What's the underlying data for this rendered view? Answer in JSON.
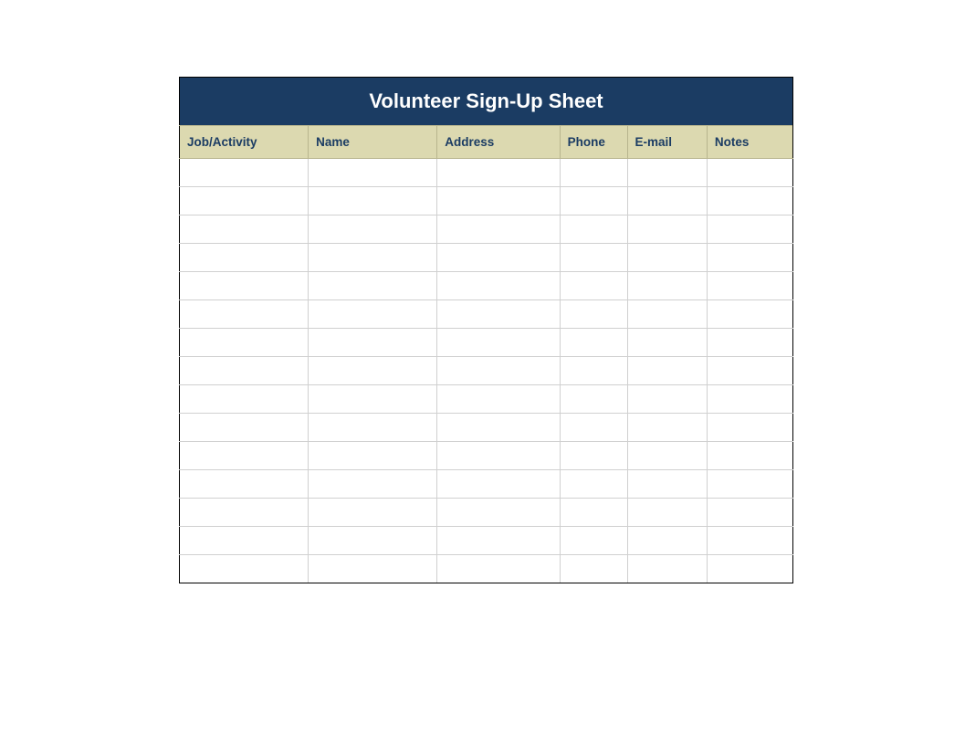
{
  "title": "Volunteer Sign-Up Sheet",
  "columns": {
    "job": "Job/Activity",
    "name": "Name",
    "address": "Address",
    "phone": "Phone",
    "email": "E-mail",
    "notes": "Notes"
  },
  "rows": [
    {
      "job": "",
      "name": "",
      "address": "",
      "phone": "",
      "email": "",
      "notes": ""
    },
    {
      "job": "",
      "name": "",
      "address": "",
      "phone": "",
      "email": "",
      "notes": ""
    },
    {
      "job": "",
      "name": "",
      "address": "",
      "phone": "",
      "email": "",
      "notes": ""
    },
    {
      "job": "",
      "name": "",
      "address": "",
      "phone": "",
      "email": "",
      "notes": ""
    },
    {
      "job": "",
      "name": "",
      "address": "",
      "phone": "",
      "email": "",
      "notes": ""
    },
    {
      "job": "",
      "name": "",
      "address": "",
      "phone": "",
      "email": "",
      "notes": ""
    },
    {
      "job": "",
      "name": "",
      "address": "",
      "phone": "",
      "email": "",
      "notes": ""
    },
    {
      "job": "",
      "name": "",
      "address": "",
      "phone": "",
      "email": "",
      "notes": ""
    },
    {
      "job": "",
      "name": "",
      "address": "",
      "phone": "",
      "email": "",
      "notes": ""
    },
    {
      "job": "",
      "name": "",
      "address": "",
      "phone": "",
      "email": "",
      "notes": ""
    },
    {
      "job": "",
      "name": "",
      "address": "",
      "phone": "",
      "email": "",
      "notes": ""
    },
    {
      "job": "",
      "name": "",
      "address": "",
      "phone": "",
      "email": "",
      "notes": ""
    },
    {
      "job": "",
      "name": "",
      "address": "",
      "phone": "",
      "email": "",
      "notes": ""
    },
    {
      "job": "",
      "name": "",
      "address": "",
      "phone": "",
      "email": "",
      "notes": ""
    },
    {
      "job": "",
      "name": "",
      "address": "",
      "phone": "",
      "email": "",
      "notes": ""
    }
  ]
}
